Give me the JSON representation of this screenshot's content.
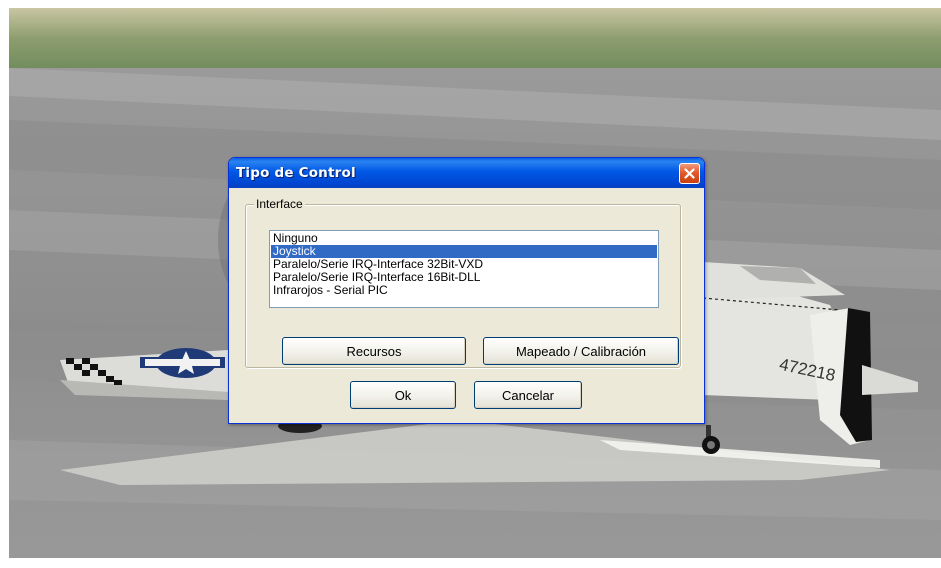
{
  "dialog": {
    "title": "Tipo de Control",
    "close_icon": "close-icon",
    "group_label": "Interface",
    "list_items": [
      "Ninguno",
      "Joystick",
      "Paralelo/Serie IRQ-Interface 32Bit-VXD",
      "Paralelo/Serie IRQ-Interface 16Bit-DLL",
      "Infrarojos - Serial PIC"
    ],
    "selected_item": "Joystick",
    "buttons": {
      "recursos": "Recursos",
      "mapeado": "Mapeado / Calibración",
      "ok": "Ok",
      "cancelar": "Cancelar"
    }
  },
  "scene": {
    "tail_number": "472218"
  },
  "colors": {
    "titlebar": "#0058e6",
    "selection": "#316ac5",
    "close_button": "#e35a2a",
    "dialog_face": "#ece9d8"
  }
}
